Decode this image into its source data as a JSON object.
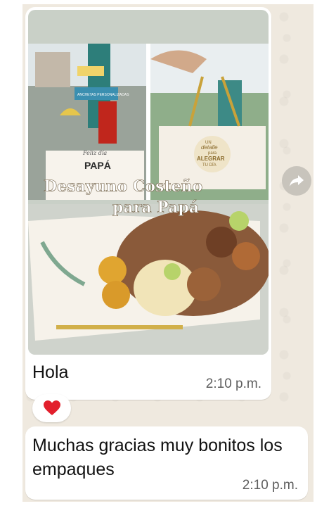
{
  "messages": [
    {
      "image": {
        "overlay_title_line1": "Desayuno Costeño",
        "overlay_title_line2": "para Papá",
        "box_label_small": "Feliz día",
        "box_label_big": "PAPÁ",
        "bag_text_line1": "UN",
        "bag_text_line2": "detalle",
        "bag_text_line3": "para",
        "bag_text_line4": "ALEGRAR",
        "bag_text_line5": "TU DÍA",
        "sign_text": "ANCHETAS PERSONALIZADAS"
      },
      "text": "Hola",
      "time": "2:10 p.m.",
      "reaction": "❤️"
    },
    {
      "text": "Muchas gracias muy bonitos los empaques",
      "time": "2:10 p.m."
    }
  ],
  "colors": {
    "chat_background": "#efe9df",
    "bubble": "#ffffff",
    "time_text": "#5e5e5e",
    "forward_button": "#c8c4bc"
  },
  "icons": {
    "forward": "share-forward-icon",
    "reaction": "red-heart-icon"
  }
}
